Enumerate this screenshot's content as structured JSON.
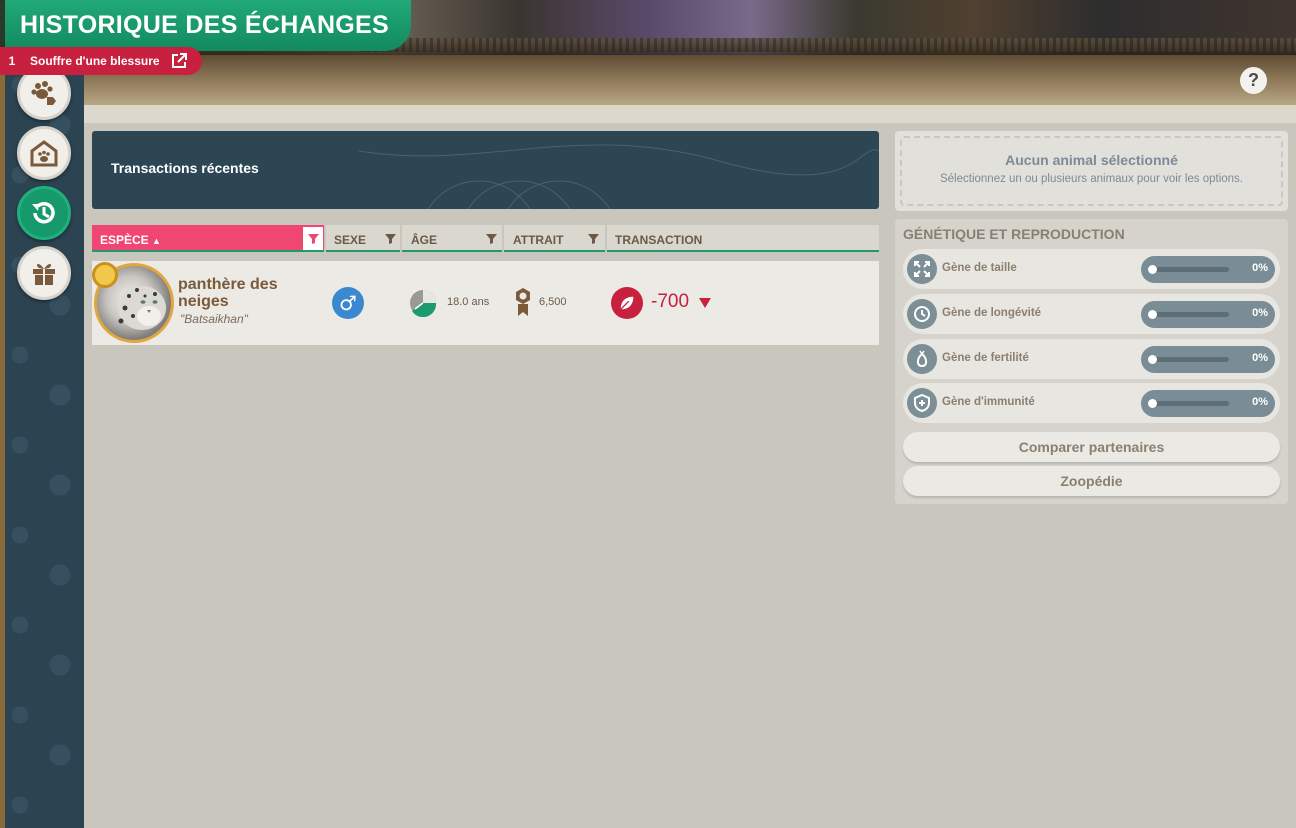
{
  "window": {
    "title": "HISTORIQUE DES ÉCHANGES"
  },
  "alert": {
    "count": "1",
    "text": "Souffre d'une blessure"
  },
  "help": {
    "label": "?"
  },
  "sidebar": {
    "items": [
      {
        "name": "animals",
        "icon": "paw-tag-icon"
      },
      {
        "name": "habitats",
        "icon": "habitat-paw-icon"
      },
      {
        "name": "history",
        "icon": "history-icon",
        "active": true
      },
      {
        "name": "gifts",
        "icon": "gift-icon"
      }
    ]
  },
  "main": {
    "panel_title": "Transactions récentes",
    "columns": [
      {
        "label": "ESPÈCE",
        "sorted": "asc"
      },
      {
        "label": "SEXE"
      },
      {
        "label": "ÂGE"
      },
      {
        "label": "ATTRAIT"
      },
      {
        "label": "TRANSACTION"
      }
    ],
    "rows": [
      {
        "species": "panthère des neiges",
        "nickname": "\"Batsaikhan\"",
        "sex_symbol": "♂",
        "age": "18.0 ans",
        "appeal": "6,500",
        "transaction": "-700"
      }
    ]
  },
  "right": {
    "no_selection_title": "Aucun animal sélectionné",
    "no_selection_sub": "Sélectionnez un ou plusieurs animaux pour voir les options.",
    "genetics_title": "GÉNÉTIQUE ET REPRODUCTION",
    "genes": [
      {
        "label": "Gène de taille",
        "value": "0%",
        "icon": "expand-icon"
      },
      {
        "label": "Gène de longévité",
        "value": "0%",
        "icon": "clock-icon"
      },
      {
        "label": "Gène de fertilité",
        "value": "0%",
        "icon": "fertility-icon"
      },
      {
        "label": "Gène d'immunité",
        "value": "0%",
        "icon": "shield-plus-icon"
      }
    ],
    "compare_label": "Comparer partenaires",
    "zoopedia_label": "Zoopédie"
  },
  "colors": {
    "accent_green": "#169a6c",
    "accent_pink": "#f04672",
    "negative_red": "#c8203f",
    "male_blue": "#3a88cf",
    "panel_dark": "#2d4654"
  }
}
